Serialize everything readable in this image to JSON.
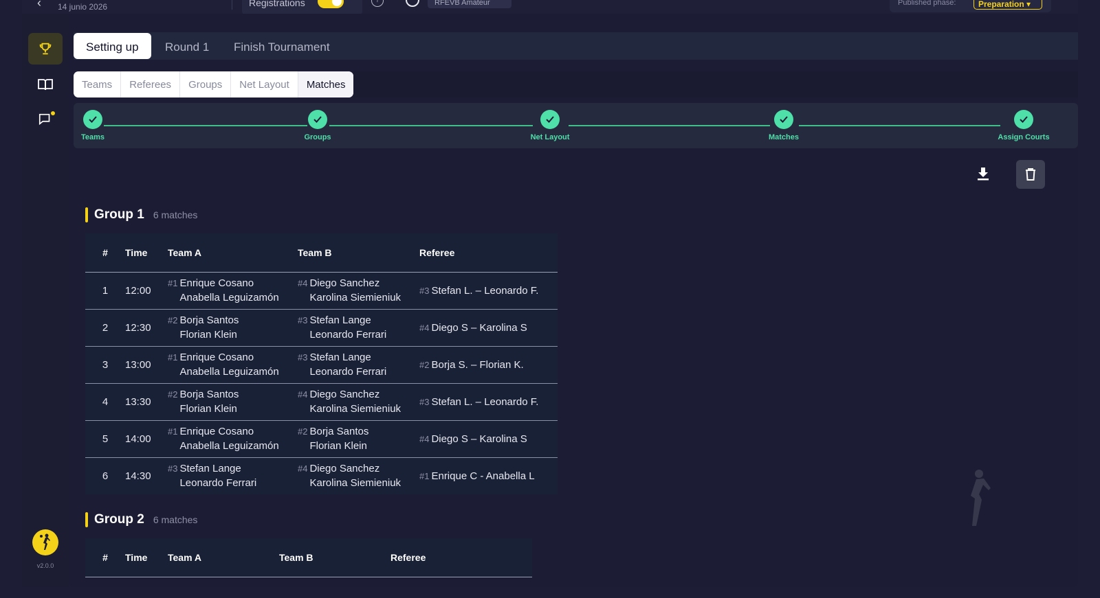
{
  "topbar": {
    "back_icon": "chevron-left-icon",
    "date": "14 junio 2026",
    "registrations_label": "Registrations",
    "registrations_on": true,
    "help_icon": "help-circle-icon",
    "refresh_icon": "circle-icon",
    "division_chip": "RFEVB Amateur",
    "published_phase_label": "Published phase:",
    "published_phase_value": "Preparation ▾"
  },
  "sidebar": {
    "items": [
      {
        "icon": "trophy-icon",
        "active": true
      },
      {
        "icon": "book-icon",
        "active": false
      },
      {
        "icon": "chat-icon",
        "active": false,
        "notification": true
      }
    ],
    "version": "v2.0.0"
  },
  "phase_tabs": [
    {
      "label": "Setting up",
      "active": true
    },
    {
      "label": "Round 1",
      "active": false
    },
    {
      "label": "Finish Tournament",
      "active": false
    }
  ],
  "sub_tabs": [
    {
      "label": "Teams",
      "active": false
    },
    {
      "label": "Referees",
      "active": false
    },
    {
      "label": "Groups",
      "active": false
    },
    {
      "label": "Net Layout",
      "active": false
    },
    {
      "label": "Matches",
      "active": true
    }
  ],
  "stepper": [
    {
      "label": "Teams",
      "done": true
    },
    {
      "label": "Groups",
      "done": true
    },
    {
      "label": "Net Layout",
      "done": true
    },
    {
      "label": "Matches",
      "done": true
    },
    {
      "label": "Assign Courts",
      "done": true
    }
  ],
  "actions": {
    "download_icon": "download-icon",
    "delete_icon": "trash-icon"
  },
  "columns": {
    "num": "#",
    "time": "Time",
    "team_a": "Team A",
    "team_b": "Team B",
    "referee": "Referee"
  },
  "groups": [
    {
      "title": "Group 1",
      "count": "6 matches",
      "matches": [
        {
          "num": "1",
          "time": "12:00",
          "team_a": {
            "seed": "#1",
            "p1": "Enrique Cosano",
            "p2": "Anabella Leguizamón"
          },
          "team_b": {
            "seed": "#4",
            "p1": "Diego Sanchez",
            "p2": "Karolina Siemieniuk"
          },
          "referee": {
            "seed": "#3",
            "name": "Stefan L. – Leonardo F."
          }
        },
        {
          "num": "2",
          "time": "12:30",
          "team_a": {
            "seed": "#2",
            "p1": "Borja Santos",
            "p2": "Florian Klein"
          },
          "team_b": {
            "seed": "#3",
            "p1": "Stefan Lange",
            "p2": "Leonardo Ferrari"
          },
          "referee": {
            "seed": "#4",
            "name": "Diego  S – Karolina S"
          }
        },
        {
          "num": "3",
          "time": "13:00",
          "team_a": {
            "seed": "#1",
            "p1": "Enrique Cosano",
            "p2": "Anabella Leguizamón"
          },
          "team_b": {
            "seed": "#3",
            "p1": "Stefan Lange",
            "p2": "Leonardo Ferrari"
          },
          "referee": {
            "seed": "#2",
            "name": "Borja S. – Florian K."
          }
        },
        {
          "num": "4",
          "time": "13:30",
          "team_a": {
            "seed": "#2",
            "p1": "Borja Santos",
            "p2": "Florian Klein"
          },
          "team_b": {
            "seed": "#4",
            "p1": "Diego Sanchez",
            "p2": "Karolina Siemieniuk"
          },
          "referee": {
            "seed": "#3",
            "name": "Stefan L. – Leonardo F."
          }
        },
        {
          "num": "5",
          "time": "14:00",
          "team_a": {
            "seed": "#1",
            "p1": "Enrique Cosano",
            "p2": "Anabella Leguizamón"
          },
          "team_b": {
            "seed": "#2",
            "p1": "Borja Santos",
            "p2": "Florian Klein"
          },
          "referee": {
            "seed": "#4",
            "name": "Diego  S – Karolina S"
          }
        },
        {
          "num": "6",
          "time": "14:30",
          "team_a": {
            "seed": "#3",
            "p1": "Stefan Lange",
            "p2": "Leonardo Ferrari"
          },
          "team_b": {
            "seed": "#4",
            "p1": "Diego Sanchez",
            "p2": "Karolina Siemieniuk"
          },
          "referee": {
            "seed": "#1",
            "name": "Enrique C - Anabella L"
          }
        }
      ]
    },
    {
      "title": "Group 2",
      "count": "6 matches",
      "matches": []
    }
  ],
  "colors": {
    "accent": "#f5d21a",
    "success": "#4ee0a8",
    "background": "#1d1d35"
  }
}
